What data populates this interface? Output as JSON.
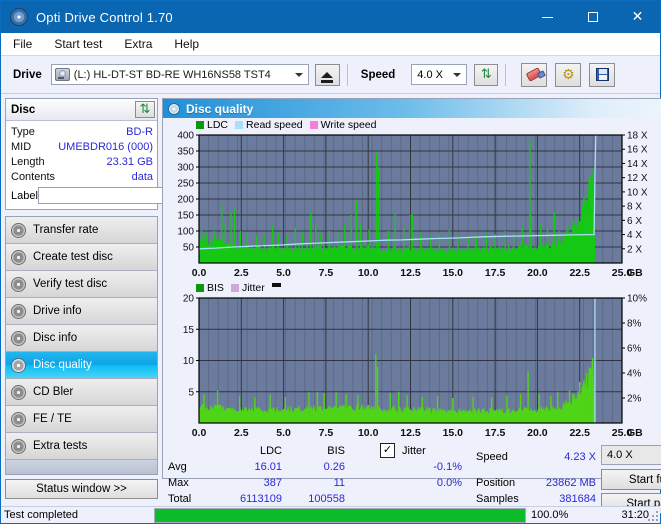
{
  "window": {
    "title": "Opti Drive Control 1.70",
    "icon": "disc-icon",
    "minimize": "–",
    "maximize": "□",
    "close": "✕"
  },
  "menu": [
    "File",
    "Start test",
    "Extra",
    "Help"
  ],
  "toolbar": {
    "drive_label": "Drive",
    "drive_value": "(L:)  HL-DT-ST BD-RE  WH16NS58 TST4",
    "eject_icon": "eject-icon",
    "speed_label": "Speed",
    "speed_value": "4.0 X",
    "refresh_icon": "refresh-icon",
    "erase_icon": "eraser-icon",
    "gear_icon": "gear-icon",
    "save_icon": "save-icon"
  },
  "disc": {
    "header": "Disc",
    "refresh_icon": "refresh-icon",
    "rows": [
      {
        "key": "Type",
        "value": "BD-R"
      },
      {
        "key": "MID",
        "value": "UMEBDR016 (000)"
      },
      {
        "key": "Length",
        "value": "23.31 GB"
      },
      {
        "key": "Contents",
        "value": "data"
      }
    ],
    "label_key": "Label",
    "label_value": "",
    "label_placeholder": "",
    "label_button_icon": "cd-icon"
  },
  "nav": {
    "items": [
      {
        "label": "Transfer rate",
        "icon": "disc-icon",
        "active": false
      },
      {
        "label": "Create test disc",
        "icon": "disc-icon",
        "active": false
      },
      {
        "label": "Verify test disc",
        "icon": "disc-icon",
        "active": false
      },
      {
        "label": "Drive info",
        "icon": "disc-icon",
        "active": false
      },
      {
        "label": "Disc info",
        "icon": "disc-icon",
        "active": false
      },
      {
        "label": "Disc quality",
        "icon": "disc-icon",
        "active": true
      },
      {
        "label": "CD Bler",
        "icon": "disc-icon",
        "active": false
      },
      {
        "label": "FE / TE",
        "icon": "disc-icon",
        "active": false
      },
      {
        "label": "Extra tests",
        "icon": "disc-icon",
        "active": false
      }
    ],
    "status_window": "Status window >>"
  },
  "panel": {
    "title": "Disc quality",
    "icon": "disc-icon"
  },
  "stats": {
    "col_headers": [
      "LDC",
      "BIS"
    ],
    "row_headers": [
      "Avg",
      "Max",
      "Total"
    ],
    "ldc": {
      "avg": "16.01",
      "max": "387",
      "total": "6113109"
    },
    "bis": {
      "avg": "0.26",
      "max": "11",
      "total": "100558"
    },
    "jitter_label": "Jitter",
    "jitter_checked": true,
    "jitter_avg": "-0.1%",
    "jitter_max": "0.0%",
    "speed_label": "Speed",
    "speed_value": "4.23 X",
    "position_label": "Position",
    "position_value": "23862 MB",
    "samples_label": "Samples",
    "samples_value": "381684",
    "speed_select": "4.0 X",
    "start_full": "Start full",
    "start_part": "Start part"
  },
  "statusbar": {
    "message": "Test completed",
    "progress_percent": 100.0,
    "progress_text": "100.0%",
    "time": "31:20"
  },
  "colors": {
    "accent": "#0b66b2",
    "plot_bg": "#6b7b9e",
    "grid": "#32353f",
    "ldc_green": "#14c814",
    "bis_green": "#4fd417",
    "read_speed": "#a9dffb",
    "write_speed": "#f77ce0",
    "jitter": "#cfa8d8",
    "value_blue": "#2a2ad4",
    "progress_green": "#0bbd2a"
  },
  "chart_data": [
    {
      "type": "area",
      "name": "ldc-chart",
      "title": "",
      "xlabel": "GB",
      "ylabel": "",
      "xlim": [
        0,
        25
      ],
      "xticks": [
        0.0,
        2.5,
        5.0,
        7.5,
        10.0,
        12.5,
        15.0,
        17.5,
        20.0,
        22.5,
        25.0
      ],
      "xticklabels": [
        "0.0",
        "2.5",
        "5.0",
        "7.5",
        "10.0",
        "12.5",
        "15.0",
        "17.5",
        "20.0",
        "22.5",
        "25.0"
      ],
      "ylim": [
        0,
        400
      ],
      "yticks": [
        50,
        100,
        150,
        200,
        250,
        300,
        350,
        400
      ],
      "yticklabels": [
        "50",
        "100",
        "150",
        "200",
        "250",
        "300",
        "350",
        "400"
      ],
      "y2lim": [
        0,
        18
      ],
      "y2ticks": [
        2,
        4,
        6,
        8,
        10,
        12,
        14,
        16,
        18
      ],
      "y2ticklabels": [
        "2 X",
        "4 X",
        "6 X",
        "8 X",
        "10 X",
        "12 X",
        "14 X",
        "16 X",
        "18 X"
      ],
      "grid": true,
      "legend": [
        "LDC",
        "Read speed",
        "Write speed"
      ],
      "legend_position": "top-left",
      "data_end_gb": 23.4,
      "series": [
        {
          "name": "LDC",
          "color": "#14c814",
          "baseline": [
            {
              "x": 0.0,
              "y": 72
            },
            {
              "x": 0.6,
              "y": 68
            },
            {
              "x": 1.2,
              "y": 62
            },
            {
              "x": 2.0,
              "y": 55
            },
            {
              "x": 3.0,
              "y": 48
            },
            {
              "x": 4.0,
              "y": 45
            },
            {
              "x": 5.0,
              "y": 45
            },
            {
              "x": 6.0,
              "y": 46
            },
            {
              "x": 7.0,
              "y": 48
            },
            {
              "x": 8.0,
              "y": 50
            },
            {
              "x": 9.0,
              "y": 50
            },
            {
              "x": 10.0,
              "y": 48
            },
            {
              "x": 11.0,
              "y": 44
            },
            {
              "x": 12.0,
              "y": 42
            },
            {
              "x": 13.0,
              "y": 40
            },
            {
              "x": 14.0,
              "y": 40
            },
            {
              "x": 15.0,
              "y": 40
            },
            {
              "x": 16.0,
              "y": 40
            },
            {
              "x": 17.0,
              "y": 42
            },
            {
              "x": 18.0,
              "y": 45
            },
            {
              "x": 19.0,
              "y": 50
            },
            {
              "x": 20.0,
              "y": 52
            },
            {
              "x": 21.0,
              "y": 62
            },
            {
              "x": 21.6,
              "y": 78
            },
            {
              "x": 22.0,
              "y": 100
            },
            {
              "x": 22.4,
              "y": 130
            },
            {
              "x": 22.7,
              "y": 170
            },
            {
              "x": 23.0,
              "y": 215
            },
            {
              "x": 23.2,
              "y": 250
            },
            {
              "x": 23.38,
              "y": 265
            },
            {
              "x": 23.4,
              "y": 0
            }
          ],
          "spikes": [
            {
              "x": 0.15,
              "y": 105
            },
            {
              "x": 0.45,
              "y": 95
            },
            {
              "x": 0.9,
              "y": 100
            },
            {
              "x": 1.35,
              "y": 182
            },
            {
              "x": 1.55,
              "y": 120
            },
            {
              "x": 1.9,
              "y": 160
            },
            {
              "x": 2.1,
              "y": 168
            },
            {
              "x": 2.45,
              "y": 100
            },
            {
              "x": 2.85,
              "y": 95
            },
            {
              "x": 3.4,
              "y": 85
            },
            {
              "x": 3.9,
              "y": 90
            },
            {
              "x": 4.35,
              "y": 115
            },
            {
              "x": 4.7,
              "y": 95
            },
            {
              "x": 5.2,
              "y": 88
            },
            {
              "x": 5.7,
              "y": 112
            },
            {
              "x": 6.1,
              "y": 95
            },
            {
              "x": 6.6,
              "y": 158
            },
            {
              "x": 6.9,
              "y": 122
            },
            {
              "x": 7.2,
              "y": 95
            },
            {
              "x": 7.7,
              "y": 100
            },
            {
              "x": 8.2,
              "y": 98
            },
            {
              "x": 8.6,
              "y": 120
            },
            {
              "x": 9.0,
              "y": 150
            },
            {
              "x": 9.3,
              "y": 196
            },
            {
              "x": 9.55,
              "y": 120
            },
            {
              "x": 10.05,
              "y": 105
            },
            {
              "x": 10.5,
              "y": 345
            },
            {
              "x": 10.62,
              "y": 300
            },
            {
              "x": 11.2,
              "y": 100
            },
            {
              "x": 11.6,
              "y": 158
            },
            {
              "x": 12.1,
              "y": 110
            },
            {
              "x": 12.45,
              "y": 150
            },
            {
              "x": 12.6,
              "y": 155
            },
            {
              "x": 13.1,
              "y": 95
            },
            {
              "x": 13.7,
              "y": 88
            },
            {
              "x": 14.2,
              "y": 92
            },
            {
              "x": 14.8,
              "y": 105
            },
            {
              "x": 15.3,
              "y": 90
            },
            {
              "x": 15.9,
              "y": 85
            },
            {
              "x": 16.4,
              "y": 88
            },
            {
              "x": 17.0,
              "y": 95
            },
            {
              "x": 17.5,
              "y": 90
            },
            {
              "x": 18.1,
              "y": 100
            },
            {
              "x": 18.6,
              "y": 95
            },
            {
              "x": 19.1,
              "y": 110
            },
            {
              "x": 19.55,
              "y": 388
            },
            {
              "x": 19.62,
              "y": 150
            },
            {
              "x": 20.2,
              "y": 120
            },
            {
              "x": 20.6,
              "y": 105
            },
            {
              "x": 21.0,
              "y": 158
            },
            {
              "x": 21.3,
              "y": 100
            },
            {
              "x": 21.8,
              "y": 120
            }
          ]
        },
        {
          "name": "Read speed",
          "color": "#a9dffb",
          "unit": "X",
          "points": [
            {
              "x": 0.0,
              "y": 2.0
            },
            {
              "x": 1.0,
              "y": 2.1
            },
            {
              "x": 2.0,
              "y": 2.25
            },
            {
              "x": 3.0,
              "y": 2.35
            },
            {
              "x": 4.0,
              "y": 2.45
            },
            {
              "x": 5.0,
              "y": 2.55
            },
            {
              "x": 6.0,
              "y": 2.7
            },
            {
              "x": 7.0,
              "y": 2.8
            },
            {
              "x": 8.0,
              "y": 2.9
            },
            {
              "x": 9.0,
              "y": 3.0
            },
            {
              "x": 10.0,
              "y": 3.1
            },
            {
              "x": 11.0,
              "y": 3.2
            },
            {
              "x": 12.0,
              "y": 3.25
            },
            {
              "x": 13.0,
              "y": 3.35
            },
            {
              "x": 14.0,
              "y": 3.45
            },
            {
              "x": 15.0,
              "y": 3.5
            },
            {
              "x": 16.0,
              "y": 3.6
            },
            {
              "x": 17.0,
              "y": 3.7
            },
            {
              "x": 18.0,
              "y": 3.75
            },
            {
              "x": 19.0,
              "y": 3.8
            },
            {
              "x": 20.0,
              "y": 3.85
            },
            {
              "x": 21.0,
              "y": 3.9
            },
            {
              "x": 22.0,
              "y": 3.95
            },
            {
              "x": 23.0,
              "y": 4.0
            },
            {
              "x": 23.35,
              "y": 4.0
            },
            {
              "x": 23.4,
              "y": 12.0
            },
            {
              "x": 23.45,
              "y": 18.0
            }
          ]
        },
        {
          "name": "Write speed",
          "color": "#f77ce0",
          "points": []
        }
      ]
    },
    {
      "type": "area",
      "name": "bis-chart",
      "title": "",
      "xlabel": "GB",
      "xlim": [
        0,
        25
      ],
      "xticks": [
        0.0,
        2.5,
        5.0,
        7.5,
        10.0,
        12.5,
        15.0,
        17.5,
        20.0,
        22.5,
        25.0
      ],
      "xticklabels": [
        "0.0",
        "2.5",
        "5.0",
        "7.5",
        "10.0",
        "12.5",
        "15.0",
        "17.5",
        "20.0",
        "22.5",
        "25.0"
      ],
      "ylim": [
        0,
        20
      ],
      "yticks": [
        5,
        10,
        15,
        20
      ],
      "yticklabels": [
        "5",
        "10",
        "15",
        "20"
      ],
      "y2lim": [
        0,
        10
      ],
      "y2ticks": [
        2,
        4,
        6,
        8,
        10
      ],
      "y2ticklabels": [
        "2%",
        "4%",
        "6%",
        "8%",
        "10%"
      ],
      "grid": true,
      "legend": [
        "BIS",
        "Jitter"
      ],
      "legend_position": "top-left",
      "data_end_gb": 23.4,
      "series": [
        {
          "name": "BIS",
          "color": "#4fd417",
          "baseline": [
            {
              "x": 0.0,
              "y": 2.6
            },
            {
              "x": 2.0,
              "y": 2.2
            },
            {
              "x": 4.0,
              "y": 2.1
            },
            {
              "x": 6.0,
              "y": 2.3
            },
            {
              "x": 8.0,
              "y": 2.5
            },
            {
              "x": 10.0,
              "y": 2.4
            },
            {
              "x": 12.0,
              "y": 2.2
            },
            {
              "x": 14.0,
              "y": 2.0
            },
            {
              "x": 16.0,
              "y": 1.9
            },
            {
              "x": 18.0,
              "y": 2.0
            },
            {
              "x": 20.0,
              "y": 2.2
            },
            {
              "x": 21.5,
              "y": 2.6
            },
            {
              "x": 22.2,
              "y": 4.0
            },
            {
              "x": 22.7,
              "y": 5.5
            },
            {
              "x": 23.1,
              "y": 7.5
            },
            {
              "x": 23.3,
              "y": 9.0
            },
            {
              "x": 23.4,
              "y": 0
            }
          ],
          "spikes": [
            {
              "x": 0.3,
              "y": 4.6
            },
            {
              "x": 1.1,
              "y": 5.2
            },
            {
              "x": 2.4,
              "y": 4.3
            },
            {
              "x": 3.3,
              "y": 4.1
            },
            {
              "x": 4.2,
              "y": 4.5
            },
            {
              "x": 5.1,
              "y": 4.2
            },
            {
              "x": 6.5,
              "y": 4.9
            },
            {
              "x": 7.0,
              "y": 5.0
            },
            {
              "x": 7.4,
              "y": 4.8
            },
            {
              "x": 8.1,
              "y": 4.9
            },
            {
              "x": 8.7,
              "y": 4.6
            },
            {
              "x": 9.4,
              "y": 4.4
            },
            {
              "x": 10.45,
              "y": 11.0
            },
            {
              "x": 10.55,
              "y": 9.0
            },
            {
              "x": 11.3,
              "y": 4.8
            },
            {
              "x": 11.8,
              "y": 5.0
            },
            {
              "x": 12.3,
              "y": 4.4
            },
            {
              "x": 13.2,
              "y": 4.2
            },
            {
              "x": 14.1,
              "y": 4.3
            },
            {
              "x": 15.0,
              "y": 4.0
            },
            {
              "x": 16.2,
              "y": 4.2
            },
            {
              "x": 17.3,
              "y": 4.1
            },
            {
              "x": 18.2,
              "y": 4.4
            },
            {
              "x": 19.0,
              "y": 4.6
            },
            {
              "x": 19.45,
              "y": 8.2
            },
            {
              "x": 20.1,
              "y": 4.6
            },
            {
              "x": 20.8,
              "y": 4.3
            },
            {
              "x": 21.2,
              "y": 5.0
            },
            {
              "x": 21.9,
              "y": 5.2
            },
            {
              "x": 22.5,
              "y": 6.6
            },
            {
              "x": 22.9,
              "y": 8.0
            },
            {
              "x": 23.25,
              "y": 10.4
            }
          ]
        },
        {
          "name": "Jitter",
          "color": "#cfa8d8",
          "points": []
        }
      ],
      "marker": {
        "x": 23.4,
        "y2": 10.0,
        "color": "#a9dffb",
        "type": "vline"
      }
    }
  ]
}
